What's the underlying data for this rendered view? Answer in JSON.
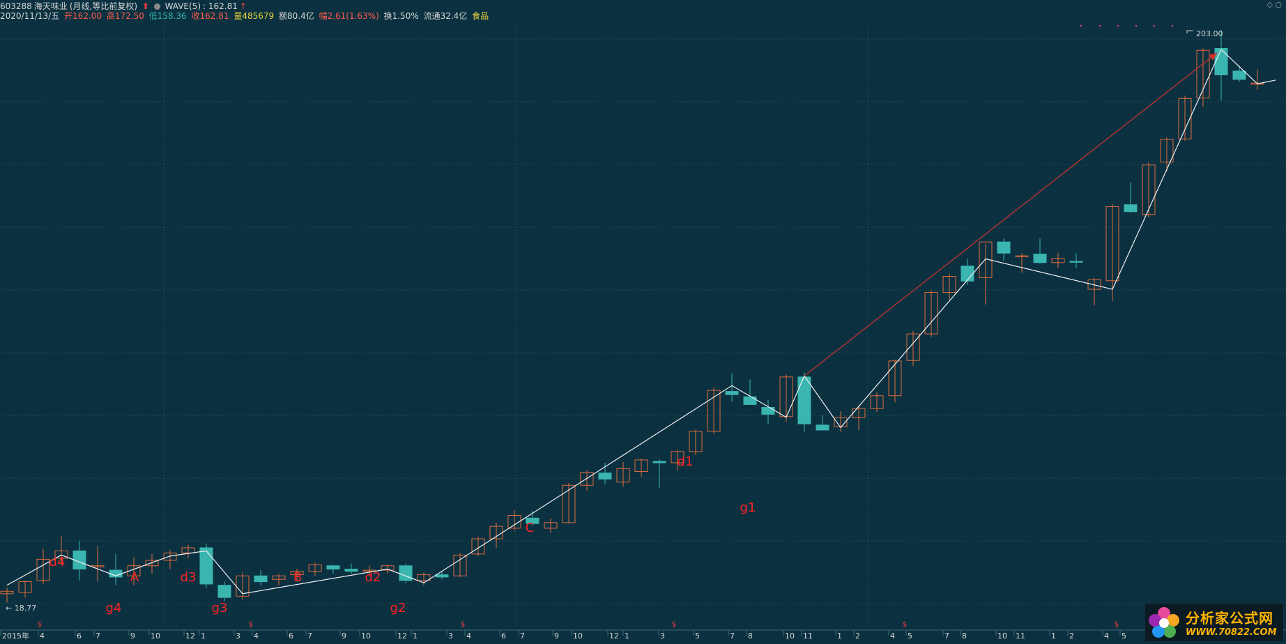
{
  "header": {
    "code": "603288",
    "name": "海天味业",
    "period": "(月线,等比前复权)",
    "indicator_label": "WAVE(5)",
    "indicator_value": ": 162.81",
    "date": "2020/11/13/五",
    "open": "开162.00",
    "high": "高172.50",
    "low": "低158.36",
    "close": "收162.81",
    "volume": "量485679",
    "amount": "额80.4亿",
    "change": "幅2.61(1.63%)",
    "turnover": "换1.50%",
    "float_cap": "流通32.4亿",
    "sector": "食品",
    "colors": {
      "up": "#e06a3c",
      "down": "#3ab5b0",
      "text": "#d6d6d6",
      "red": "#ff3b3b",
      "yellow": "#e8d43a",
      "green": "#59c45e"
    }
  },
  "top_icons": [
    "diamond-icon",
    "circle-icon"
  ],
  "top_icons_text": "◇ ○",
  "chart_data": {
    "type": "candlestick",
    "title": "",
    "price_min_label": "18.77",
    "price_max_label": "203.00",
    "x_axis_labels": [
      "2015年",
      "4",
      "6",
      "7",
      "9",
      "10",
      "12",
      "1",
      "3",
      "4",
      "6",
      "7",
      "9",
      "10",
      "12",
      "1",
      "3",
      "4",
      "6",
      "7",
      "9",
      "10",
      "12",
      "1",
      "3",
      "5",
      "7",
      "8",
      "10",
      "11",
      "1",
      "2",
      "4",
      "5",
      "7",
      "8",
      "10",
      "11",
      "1",
      "2",
      "4",
      "5"
    ],
    "dividend_marker": "$",
    "wave_labels": [
      "d4",
      "g4",
      "A",
      "d3",
      "g3",
      "B",
      "d2",
      "g2",
      "C",
      "d1",
      "g1"
    ],
    "candles": [
      {
        "o": 19.5,
        "h": 20.0,
        "l": 18.8,
        "c": 19.7
      },
      {
        "o": 19.6,
        "h": 20.6,
        "l": 19.2,
        "c": 20.5
      },
      {
        "o": 20.6,
        "h": 23.5,
        "l": 20.3,
        "c": 22.5
      },
      {
        "o": 22.6,
        "h": 24.8,
        "l": 22.0,
        "c": 23.3
      },
      {
        "o": 23.3,
        "h": 24.3,
        "l": 20.6,
        "c": 21.6
      },
      {
        "o": 21.8,
        "h": 23.8,
        "l": 20.5,
        "c": 21.9
      },
      {
        "o": 21.5,
        "h": 23.0,
        "l": 20.2,
        "c": 20.9
      },
      {
        "o": 21.0,
        "h": 22.7,
        "l": 20.2,
        "c": 21.9
      },
      {
        "o": 21.9,
        "h": 23.0,
        "l": 21.2,
        "c": 22.4
      },
      {
        "o": 22.4,
        "h": 23.4,
        "l": 21.6,
        "c": 23.1
      },
      {
        "o": 23.1,
        "h": 23.9,
        "l": 22.6,
        "c": 23.6
      },
      {
        "o": 23.6,
        "h": 24.0,
        "l": 20.0,
        "c": 20.3
      },
      {
        "o": 20.2,
        "h": 20.5,
        "l": 18.9,
        "c": 19.2
      },
      {
        "o": 19.3,
        "h": 21.3,
        "l": 19.0,
        "c": 21.0
      },
      {
        "o": 21.0,
        "h": 21.5,
        "l": 20.2,
        "c": 20.5
      },
      {
        "o": 20.7,
        "h": 21.2,
        "l": 20.2,
        "c": 21.0
      },
      {
        "o": 21.1,
        "h": 21.6,
        "l": 20.5,
        "c": 21.4
      },
      {
        "o": 21.4,
        "h": 22.2,
        "l": 21.0,
        "c": 22.0
      },
      {
        "o": 21.9,
        "h": 22.0,
        "l": 21.2,
        "c": 21.6
      },
      {
        "o": 21.6,
        "h": 22.1,
        "l": 21.2,
        "c": 21.4
      },
      {
        "o": 21.4,
        "h": 21.9,
        "l": 21.0,
        "c": 21.5
      },
      {
        "o": 21.5,
        "h": 22.0,
        "l": 21.2,
        "c": 21.9
      },
      {
        "o": 21.9,
        "h": 22.1,
        "l": 20.4,
        "c": 20.6
      },
      {
        "o": 20.6,
        "h": 21.3,
        "l": 20.2,
        "c": 21.1
      },
      {
        "o": 21.1,
        "h": 21.4,
        "l": 20.7,
        "c": 20.9
      },
      {
        "o": 21.0,
        "h": 23.1,
        "l": 20.9,
        "c": 22.9
      },
      {
        "o": 23.0,
        "h": 24.7,
        "l": 22.8,
        "c": 24.5
      },
      {
        "o": 24.5,
        "h": 26.2,
        "l": 23.6,
        "c": 25.8
      },
      {
        "o": 25.6,
        "h": 27.6,
        "l": 25.3,
        "c": 27.0
      },
      {
        "o": 26.7,
        "h": 27.5,
        "l": 25.9,
        "c": 26.1
      },
      {
        "o": 25.6,
        "h": 26.7,
        "l": 25.1,
        "c": 26.2
      },
      {
        "o": 26.2,
        "h": 30.9,
        "l": 26.1,
        "c": 30.6
      },
      {
        "o": 30.6,
        "h": 32.6,
        "l": 29.9,
        "c": 32.3
      },
      {
        "o": 32.2,
        "h": 33.6,
        "l": 30.7,
        "c": 31.4
      },
      {
        "o": 31.0,
        "h": 33.7,
        "l": 30.4,
        "c": 32.8
      },
      {
        "o": 32.4,
        "h": 34.2,
        "l": 31.7,
        "c": 34.0
      },
      {
        "o": 33.8,
        "h": 34.1,
        "l": 30.2,
        "c": 33.6
      },
      {
        "o": 33.6,
        "h": 35.4,
        "l": 32.6,
        "c": 35.2
      },
      {
        "o": 35.2,
        "h": 38.6,
        "l": 34.7,
        "c": 38.3
      },
      {
        "o": 38.3,
        "h": 46.0,
        "l": 37.9,
        "c": 45.4
      },
      {
        "o": 45.2,
        "h": 48.7,
        "l": 43.3,
        "c": 44.6
      },
      {
        "o": 44.2,
        "h": 47.5,
        "l": 43.3,
        "c": 42.8
      },
      {
        "o": 42.3,
        "h": 43.6,
        "l": 39.5,
        "c": 41.1
      },
      {
        "o": 40.7,
        "h": 48.5,
        "l": 39.8,
        "c": 48.0
      },
      {
        "o": 48.0,
        "h": 48.9,
        "l": 38.2,
        "c": 39.5
      },
      {
        "o": 39.3,
        "h": 41.0,
        "l": 38.6,
        "c": 38.5
      },
      {
        "o": 39.0,
        "h": 41.6,
        "l": 38.2,
        "c": 40.5
      },
      {
        "o": 40.5,
        "h": 42.6,
        "l": 38.5,
        "c": 42.1
      },
      {
        "o": 42.1,
        "h": 45.0,
        "l": 41.5,
        "c": 44.4
      },
      {
        "o": 44.4,
        "h": 51.6,
        "l": 43.2,
        "c": 51.3
      },
      {
        "o": 51.4,
        "h": 58.1,
        "l": 50.2,
        "c": 57.4
      },
      {
        "o": 57.4,
        "h": 68.8,
        "l": 56.7,
        "c": 68.2
      },
      {
        "o": 68.2,
        "h": 73.7,
        "l": 66.1,
        "c": 72.9
      },
      {
        "o": 76.1,
        "h": 78.4,
        "l": 70.4,
        "c": 71.5
      },
      {
        "o": 72.5,
        "h": 83.4,
        "l": 64.8,
        "c": 84.1
      },
      {
        "o": 84.1,
        "h": 85.3,
        "l": 77.8,
        "c": 80.3
      },
      {
        "o": 79.4,
        "h": 80.3,
        "l": 74.0,
        "c": 79.4
      },
      {
        "o": 80.0,
        "h": 85.3,
        "l": 76.8,
        "c": 77.2
      },
      {
        "o": 77.2,
        "h": 80.4,
        "l": 75.4,
        "c": 78.5
      },
      {
        "o": 77.6,
        "h": 80.3,
        "l": 75.4,
        "c": 77.3
      },
      {
        "o": 69.1,
        "h": 72.5,
        "l": 64.6,
        "c": 71.9
      },
      {
        "o": 71.6,
        "h": 98.5,
        "l": 65.8,
        "c": 97.4
      },
      {
        "o": 98.2,
        "h": 107.8,
        "l": 94.9,
        "c": 95.4
      },
      {
        "o": 94.3,
        "h": 117.3,
        "l": 93.1,
        "c": 115.8
      },
      {
        "o": 117.2,
        "h": 129.9,
        "l": 112.7,
        "c": 128.8
      },
      {
        "o": 129.1,
        "h": 154.5,
        "l": 128.2,
        "c": 152.7
      },
      {
        "o": 153.0,
        "h": 188.1,
        "l": 147.6,
        "c": 186.5
      },
      {
        "o": 188.0,
        "h": 203.0,
        "l": 151.3,
        "c": 168.4
      },
      {
        "o": 171.1,
        "h": 175.0,
        "l": 163.6,
        "c": 165.3
      },
      {
        "o": 162.0,
        "h": 172.5,
        "l": 158.4,
        "c": 162.8
      }
    ],
    "wave_points": [
      [
        0,
        20.2
      ],
      [
        3,
        22.9
      ],
      [
        6,
        21.0
      ],
      [
        9,
        22.8
      ],
      [
        11,
        23.3
      ],
      [
        13,
        19.5
      ],
      [
        21,
        21.6
      ],
      [
        23,
        20.4
      ],
      [
        40,
        46.3
      ],
      [
        43,
        40.6
      ],
      [
        44,
        48.2
      ],
      [
        46,
        38.9
      ],
      [
        54,
        78.4
      ],
      [
        61,
        69.1
      ],
      [
        67,
        187.2
      ],
      [
        69,
        162.3
      ],
      [
        70,
        164.8
      ]
    ],
    "arrow": {
      "from": [
        44,
        48.2
      ],
      "to": [
        67,
        187.2
      ]
    }
  },
  "logo": {
    "title": "分析家公式网",
    "url_text": "WWW.70822.COM"
  }
}
